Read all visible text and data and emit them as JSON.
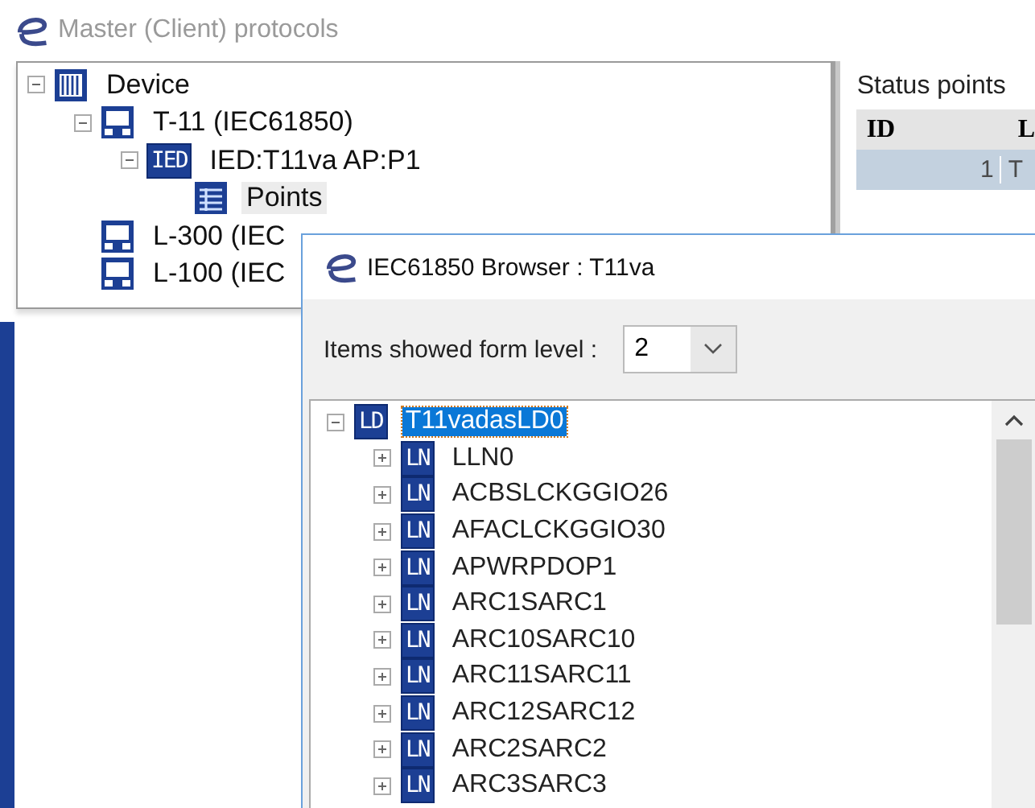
{
  "window": {
    "title": "Master (Client) protocols"
  },
  "device_tree": [
    {
      "label": "Device",
      "kind": "device",
      "expanded": true,
      "selected": false,
      "children": [
        {
          "label": "T-11 (IEC61850)",
          "kind": "network",
          "expanded": true,
          "selected": false,
          "children": [
            {
              "label": "IED:T11va AP:P1",
              "kind": "ied",
              "badge": "IED",
              "expanded": true,
              "selected": false,
              "children": [
                {
                  "label": "Points",
                  "kind": "points",
                  "selected": true
                }
              ]
            }
          ]
        },
        {
          "label": "L-300 (IEC",
          "kind": "network",
          "selected": false
        },
        {
          "label": "L-100 (IEC",
          "kind": "network",
          "selected": false
        }
      ]
    }
  ],
  "status_panel": {
    "title": "Status points",
    "columns": [
      "ID",
      "L"
    ],
    "rows": [
      {
        "cells": [
          "1",
          "T"
        ],
        "selected": true
      }
    ]
  },
  "dialog": {
    "title": "IEC61850 Browser : T11va",
    "level_label": "Items showed form level :",
    "level_value": "2",
    "tree": [
      {
        "label": "T11vadasLD0",
        "kind": "ld",
        "badge": "LD",
        "expanded": true,
        "selected": true,
        "children": [
          {
            "label": "LLN0",
            "kind": "ln",
            "badge": "LN",
            "expanded": false,
            "selected": false
          },
          {
            "label": "ACBSLCKGGIO26",
            "kind": "ln",
            "badge": "LN",
            "expanded": false,
            "selected": false
          },
          {
            "label": "AFACLCKGGIO30",
            "kind": "ln",
            "badge": "LN",
            "expanded": false,
            "selected": false
          },
          {
            "label": "APWRPDOP1",
            "kind": "ln",
            "badge": "LN",
            "expanded": false,
            "selected": false
          },
          {
            "label": "ARC1SARC1",
            "kind": "ln",
            "badge": "LN",
            "expanded": false,
            "selected": false
          },
          {
            "label": "ARC10SARC10",
            "kind": "ln",
            "badge": "LN",
            "expanded": false,
            "selected": false
          },
          {
            "label": "ARC11SARC11",
            "kind": "ln",
            "badge": "LN",
            "expanded": false,
            "selected": false
          },
          {
            "label": "ARC12SARC12",
            "kind": "ln",
            "badge": "LN",
            "expanded": false,
            "selected": false
          },
          {
            "label": "ARC2SARC2",
            "kind": "ln",
            "badge": "LN",
            "expanded": false,
            "selected": false
          },
          {
            "label": "ARC3SARC3",
            "kind": "ln",
            "badge": "LN",
            "expanded": false,
            "selected": false
          }
        ]
      }
    ]
  }
}
